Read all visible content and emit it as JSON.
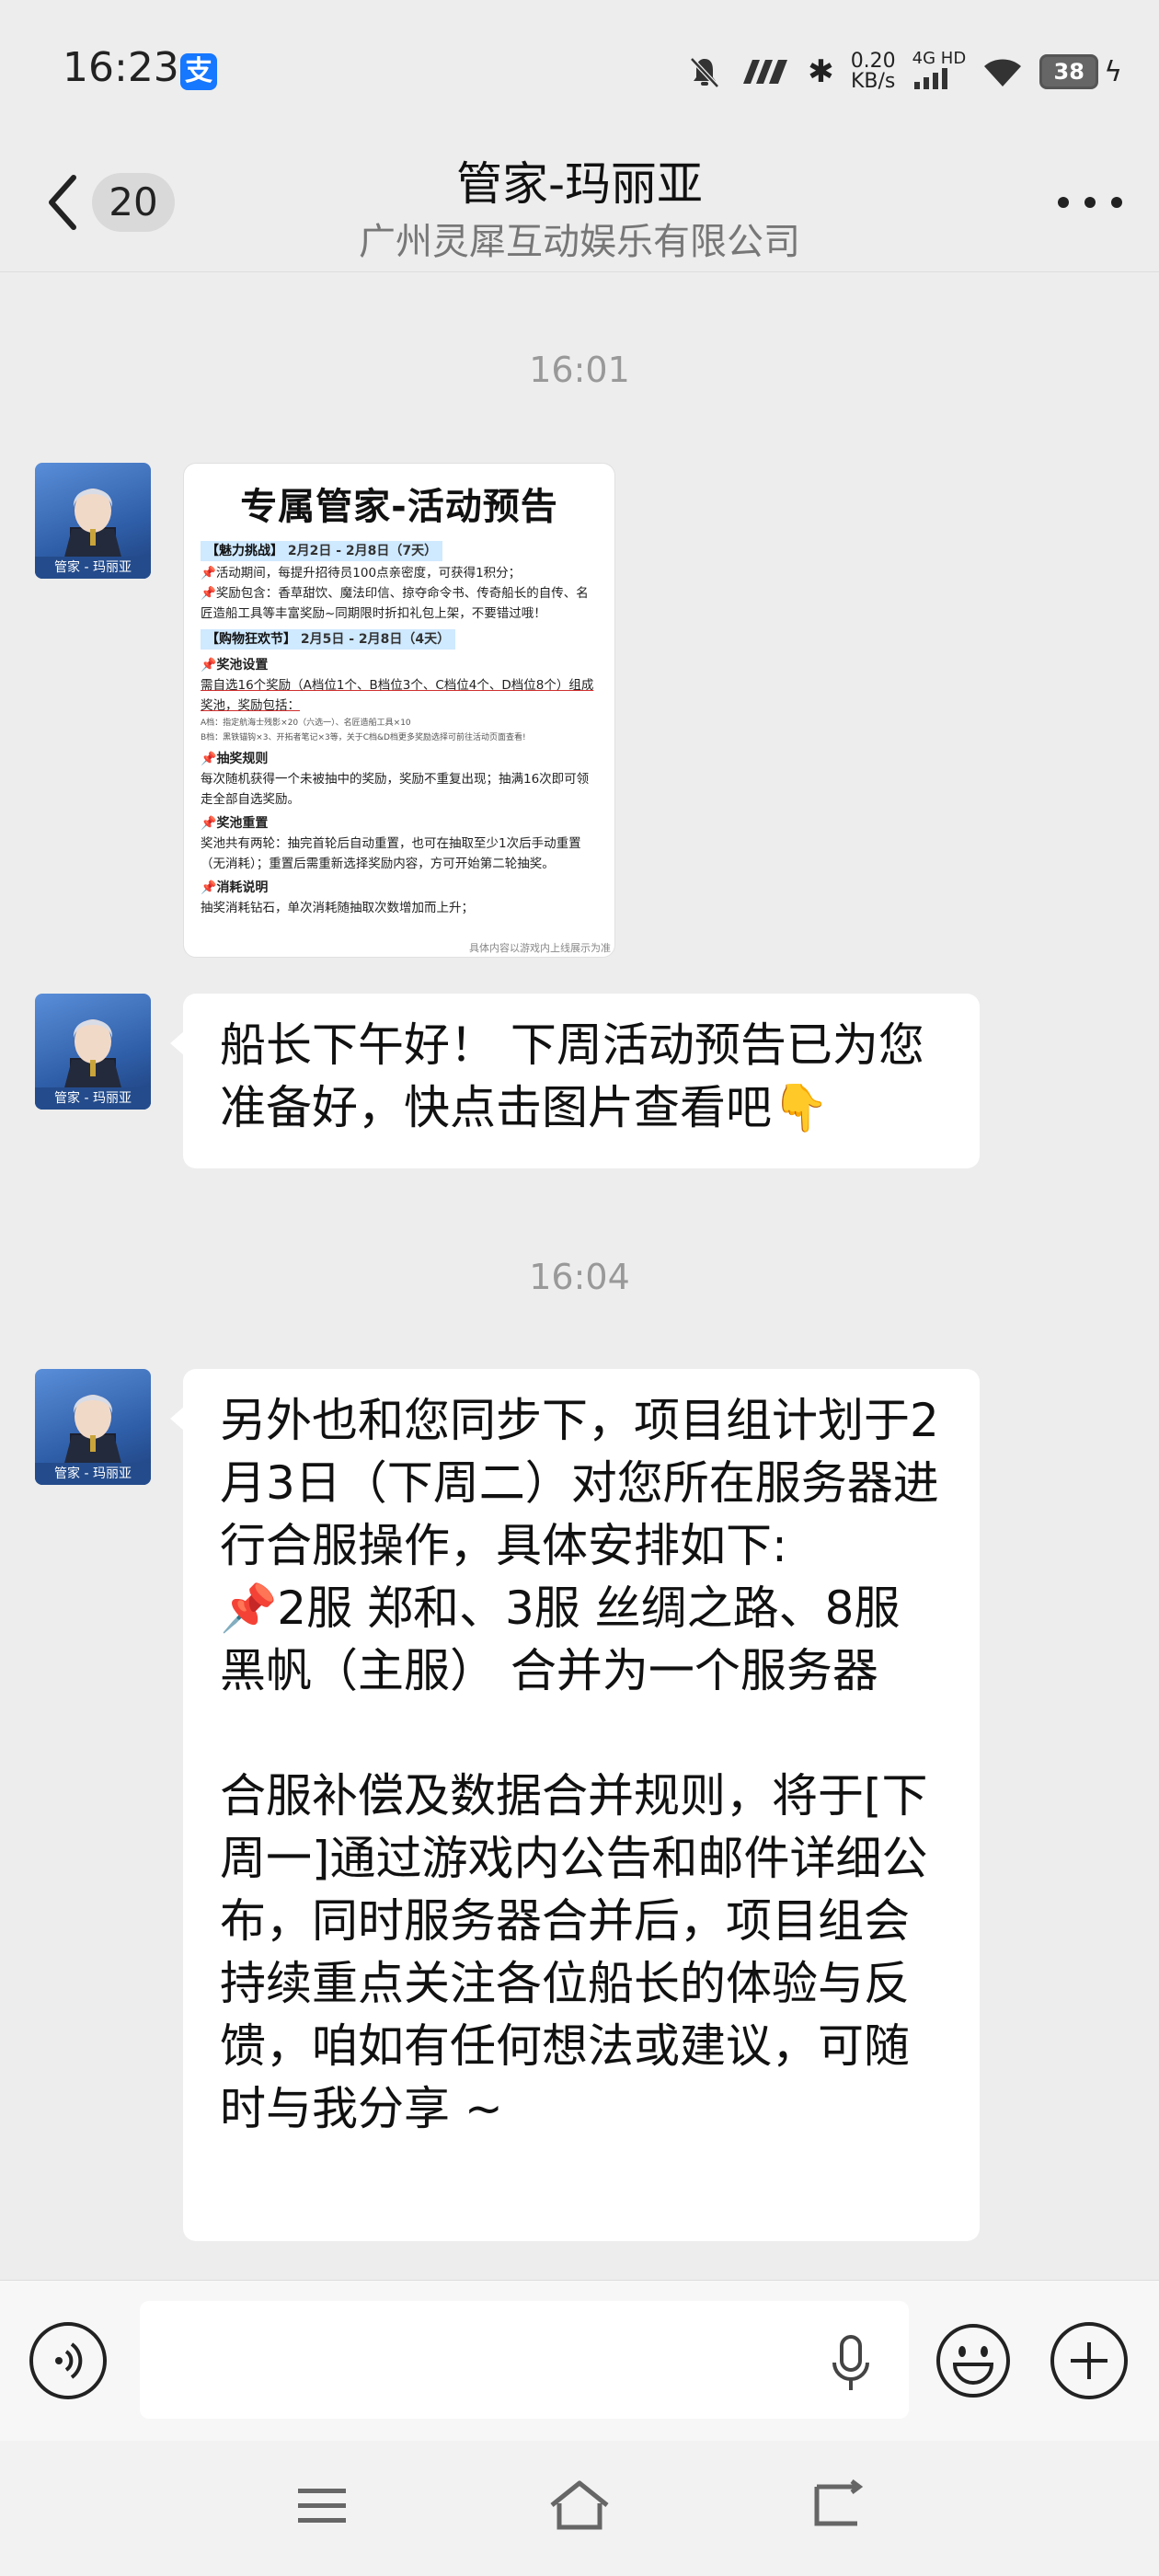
{
  "status_bar": {
    "time": "16:23",
    "app_badge": "支",
    "net_speed_value": "0.20",
    "net_speed_unit": "KB/s",
    "network_type_top": "4G HD",
    "battery": "38"
  },
  "header": {
    "unread_count": "20",
    "title": "管家-玛丽亚",
    "subtitle": "广州灵犀互动娱乐有限公司"
  },
  "messages": {
    "time1": "16:01",
    "time2": "16:04",
    "avatar_caption": "管家 - 玛丽亚",
    "image": {
      "title": "专属管家-活动预告",
      "section1_label": "【魅力挑战】",
      "section1_date": "2月2日 - 2月8日（7天）",
      "s1_line1": "活动期间，每提升招待员100点亲密度，可获得1积分；",
      "s1_line2": "奖励包含：香草甜饮、魔法印信、掠夺命令书、传奇船长的自传、名匠造船工具等丰富奖励~同期限时折扣礼包上架，不要错过哦！",
      "section2_label": "【购物狂欢节】",
      "section2_date": "2月5日 - 2月8日（4天）",
      "sub1": "奖池设置",
      "sub1_text": "需自选16个奖励（A档位1个、B档位3个、C档位4个、D档位8个）组成奖池，奖励包括：",
      "sub1_small1": "A档：指定航海士残影×20（六选一）、名匠造船工具×10",
      "sub1_small2": "B档：黑铁锚钩×3、开拓者笔记×3等，关于C档&D档更多奖励选择可前往活动页面查看!",
      "sub2": "抽奖规则",
      "sub2_text": "每次随机获得一个未被抽中的奖励，奖励不重复出现；抽满16次即可领走全部自选奖励。",
      "sub3": "奖池重置",
      "sub3_text": "奖池共有两轮：抽完首轮后自动重置，也可在抽取至少1次后手动重置（无消耗）；重置后需重新选择奖励内容，方可开始第二轮抽奖。",
      "sub4": "消耗说明",
      "sub4_text": "抽奖消耗钻石，单次消耗随抽取次数增加而上升；",
      "footer": "具体内容以游戏内上线展示为准"
    },
    "msg1": "船长下午好！ 下周活动预告已为您准备好，快点击图片查看吧👇",
    "msg2_p1": "另外也和您同步下，项目组计划于2月3日（下周二）对您所在服务器进行合服操作，具体安排如下:\n📌2服 郑和、3服 丝绸之路、8服 黑帆（主服） 合并为一个服务器",
    "msg2_p2": "合服补偿及数据合并规则，将于[下周一]通过游戏内公告和邮件详细公布，同时服务器合并后，项目组会持续重点关注各位船长的体验与反馈，咱如有任何想法或建议，可随时与我分享 ~"
  },
  "input": {
    "placeholder": ""
  },
  "icons": {
    "back": "chevron-left-icon",
    "more": "more-dots-icon",
    "voice": "voice-icon",
    "mic": "microphone-icon",
    "emoji": "emoji-icon",
    "plus": "plus-icon",
    "nav_menu": "menu-icon",
    "nav_home": "home-icon",
    "nav_back": "back-icon"
  }
}
